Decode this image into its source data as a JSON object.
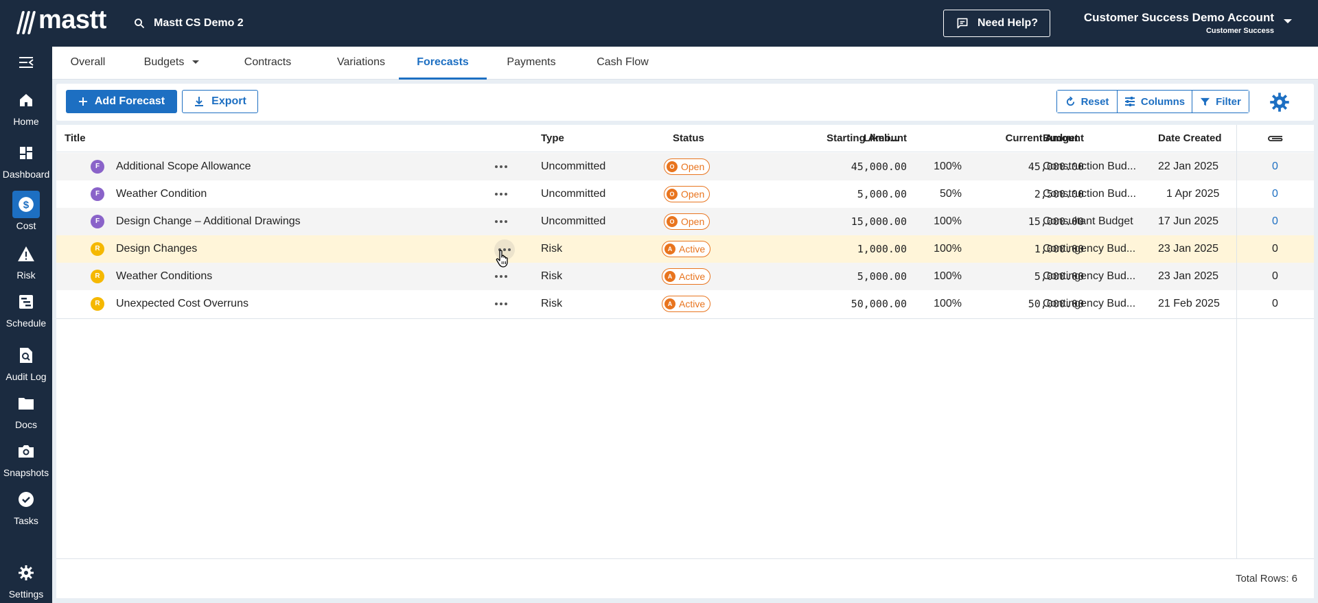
{
  "app": {
    "logo_text": "mastt",
    "project": "Mastt CS Demo 2",
    "help_label": "Need Help?",
    "account_name": "Customer Success Demo Account",
    "account_sub": "Customer Success"
  },
  "sidebar": {
    "items": [
      {
        "label": "Home",
        "icon": "home-icon"
      },
      {
        "label": "Dashboard",
        "icon": "dashboard-icon"
      },
      {
        "label": "Cost",
        "icon": "dollar-icon"
      },
      {
        "label": "Risk",
        "icon": "warning-icon"
      },
      {
        "label": "Schedule",
        "icon": "schedule-icon"
      },
      {
        "label": "Audit Log",
        "icon": "audit-log-icon"
      },
      {
        "label": "Docs",
        "icon": "folder-icon"
      },
      {
        "label": "Snapshots",
        "icon": "camera-icon"
      },
      {
        "label": "Tasks",
        "icon": "check-circle-icon"
      },
      {
        "label": "Settings",
        "icon": "gear-icon"
      }
    ]
  },
  "tabs": [
    {
      "label": "Overall"
    },
    {
      "label": "Budgets"
    },
    {
      "label": "Contracts"
    },
    {
      "label": "Variations"
    },
    {
      "label": "Forecasts"
    },
    {
      "label": "Payments"
    },
    {
      "label": "Cash Flow"
    }
  ],
  "toolbar": {
    "add_label": "Add Forecast",
    "export_label": "Export",
    "reset_label": "Reset",
    "columns_label": "Columns",
    "filter_label": "Filter"
  },
  "table": {
    "headers": {
      "title": "Title",
      "type": "Type",
      "status": "Status",
      "starting_amount": "Starting Amount",
      "likelihood": "Likeli...",
      "current_amount": "Current Amount",
      "budget": "Budget",
      "date_created": "Date Created"
    },
    "rows": [
      {
        "badge": "F",
        "title": "Additional Scope Allowance",
        "type": "Uncommitted",
        "status_letter": "O",
        "status": "Open",
        "starting": "45,000.00",
        "likelihood": "100%",
        "current": "45,000.00",
        "budget": "Construction Bud...",
        "date": "22 Jan 2025",
        "attachments": "0"
      },
      {
        "badge": "F",
        "title": "Weather Condition",
        "type": "Uncommitted",
        "status_letter": "O",
        "status": "Open",
        "starting": "5,000.00",
        "likelihood": "50%",
        "current": "2,500.00",
        "budget": "Construction Bud...",
        "date": "1 Apr 2025",
        "attachments": "0"
      },
      {
        "badge": "F",
        "title": "Design Change – Additional Drawings",
        "type": "Uncommitted",
        "status_letter": "O",
        "status": "Open",
        "starting": "15,000.00",
        "likelihood": "100%",
        "current": "15,000.00",
        "budget": "Consultant Budget",
        "date": "17 Jun 2025",
        "attachments": "0"
      },
      {
        "badge": "R",
        "title": "Design Changes",
        "type": "Risk",
        "status_letter": "A",
        "status": "Active",
        "starting": "1,000.00",
        "likelihood": "100%",
        "current": "1,000.00",
        "budget": "Contingency Bud...",
        "date": "23 Jan 2025",
        "attachments": "0"
      },
      {
        "badge": "R",
        "title": "Weather Conditions",
        "type": "Risk",
        "status_letter": "A",
        "status": "Active",
        "starting": "5,000.00",
        "likelihood": "100%",
        "current": "5,000.00",
        "budget": "Contingency Bud...",
        "date": "23 Jan 2025",
        "attachments": "0"
      },
      {
        "badge": "R",
        "title": "Unexpected Cost Overruns",
        "type": "Risk",
        "status_letter": "A",
        "status": "Active",
        "starting": "50,000.00",
        "likelihood": "100%",
        "current": "50,000.00",
        "budget": "Contingency Bud...",
        "date": "21 Feb 2025",
        "attachments": "0"
      }
    ],
    "total_rows": "Total Rows: 6"
  },
  "colors": {
    "navy": "#1b2b40",
    "accent": "#1d6fc2",
    "forecast_badge": "#8a63c9",
    "risk_badge": "#f5b800",
    "status": "#e8741e",
    "hover_row": "#fff5d9"
  }
}
